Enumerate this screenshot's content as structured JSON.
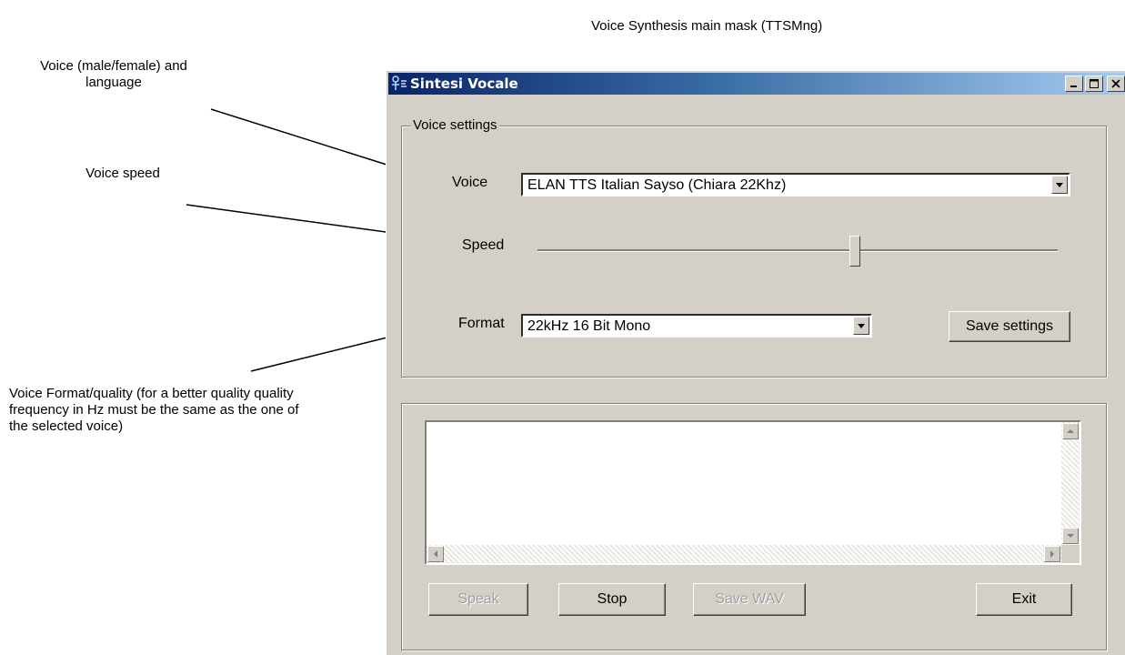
{
  "document": {
    "title": "Voice Synthesis main mask (TTSMng)",
    "annotations": {
      "voice": "Voice (male/female) and language",
      "speed": "Voice speed",
      "format": "Voice Format/quality (for a better quality quality frequency in Hz must be the same as the one of the selected voice)"
    }
  },
  "window": {
    "title": "Sintesi Vocale",
    "icon": "speech-app-icon",
    "controls": [
      "minimize-icon",
      "maximize-icon",
      "close-icon"
    ]
  },
  "voice_settings": {
    "group_label": "Voice settings",
    "voice_label": "Voice",
    "voice_value": "ELAN TTS Italian Sayso (Chiara 22Khz)",
    "speed_label": "Speed",
    "speed_level": 0.61,
    "format_label": "Format",
    "format_value": "22kHz 16 Bit Mono",
    "save_settings": "Save settings"
  },
  "text_area": {
    "value": ""
  },
  "buttons": {
    "speak": "Speak",
    "stop": "Stop",
    "save_wav": "Save WAV",
    "exit": "Exit"
  },
  "colors": {
    "titlebar_start": "#0a246a",
    "titlebar_end": "#a6caf0",
    "window_bg": "#d4d0c8"
  }
}
